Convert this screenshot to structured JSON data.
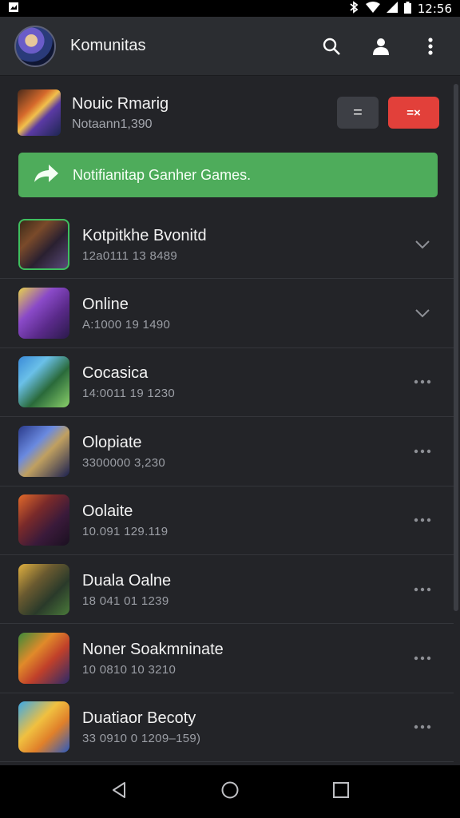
{
  "statusbar": {
    "time": "12:56"
  },
  "appbar": {
    "title": "Komunitas"
  },
  "hero": {
    "title": "Nouic Rmarig",
    "subtitle": "Notaann1,390",
    "gray_button": "=",
    "red_button": "=×"
  },
  "banner": {
    "text": "Notifianitap Ganher Games."
  },
  "items": [
    {
      "title": "Kotpitkhe Bvonitd",
      "subtitle": "12a0111 13 8489",
      "action": "chevron-down-icon",
      "thumb": "linear-gradient(135deg,#3a2a18 0%,#7a4a2a 30%,#2a2030 60%,#5a4a7a 100%)",
      "border": "#3fbf5f"
    },
    {
      "title": "Online",
      "subtitle": "A:1000 19 1490",
      "action": "chevron-down-icon",
      "thumb": "linear-gradient(135deg,#e8d24a 0%,#8a4ac8 35%,#5a2a8a 65%,#2a1a4a 100%)",
      "border": ""
    },
    {
      "title": "Cocasica",
      "subtitle": "14:0011 19 1230",
      "action": "more-icon",
      "thumb": "linear-gradient(135deg,#3a8ad8 0%,#6ac0e8 30%,#2a6a3a 60%,#8ad06a 100%)",
      "border": ""
    },
    {
      "title": "Olopiate",
      "subtitle": "3300000 3,230",
      "action": "more-icon",
      "thumb": "linear-gradient(135deg,#2a3a8a 0%,#6a8ae0 35%,#c0a060 55%,#1a2050 100%)",
      "border": ""
    },
    {
      "title": "Oolaite",
      "subtitle": "10.091 129.119",
      "action": "more-icon",
      "thumb": "linear-gradient(135deg,#e26a2a 0%,#7a2a2a 35%,#3a1a3a 65%,#1a1020 100%)",
      "border": ""
    },
    {
      "title": "Duala Oalne",
      "subtitle": "18 041 01 1239",
      "action": "more-icon",
      "thumb": "linear-gradient(135deg,#e0b040 0%,#6a5a30 35%,#2a3a2a 65%,#4a7a3a 100%)",
      "border": ""
    },
    {
      "title": "Noner Soakmninate",
      "subtitle": "10 0810 10 3210",
      "action": "more-icon",
      "thumb": "linear-gradient(135deg,#3a8a3a 0%,#e08a2a 35%,#c0402a 60%,#2a2a6a 100%)",
      "border": ""
    },
    {
      "title": "Duatiaor Becoty",
      "subtitle": "33 0910 0 1209–159)",
      "action": "more-icon",
      "thumb": "linear-gradient(135deg,#3aa8e8 0%,#f0c040 40%,#e0802a 65%,#2a5ac0 100%)",
      "border": ""
    }
  ],
  "colors": {
    "accent_green": "#4eac5b",
    "accent_red": "#e2403a",
    "background": "#232428"
  }
}
